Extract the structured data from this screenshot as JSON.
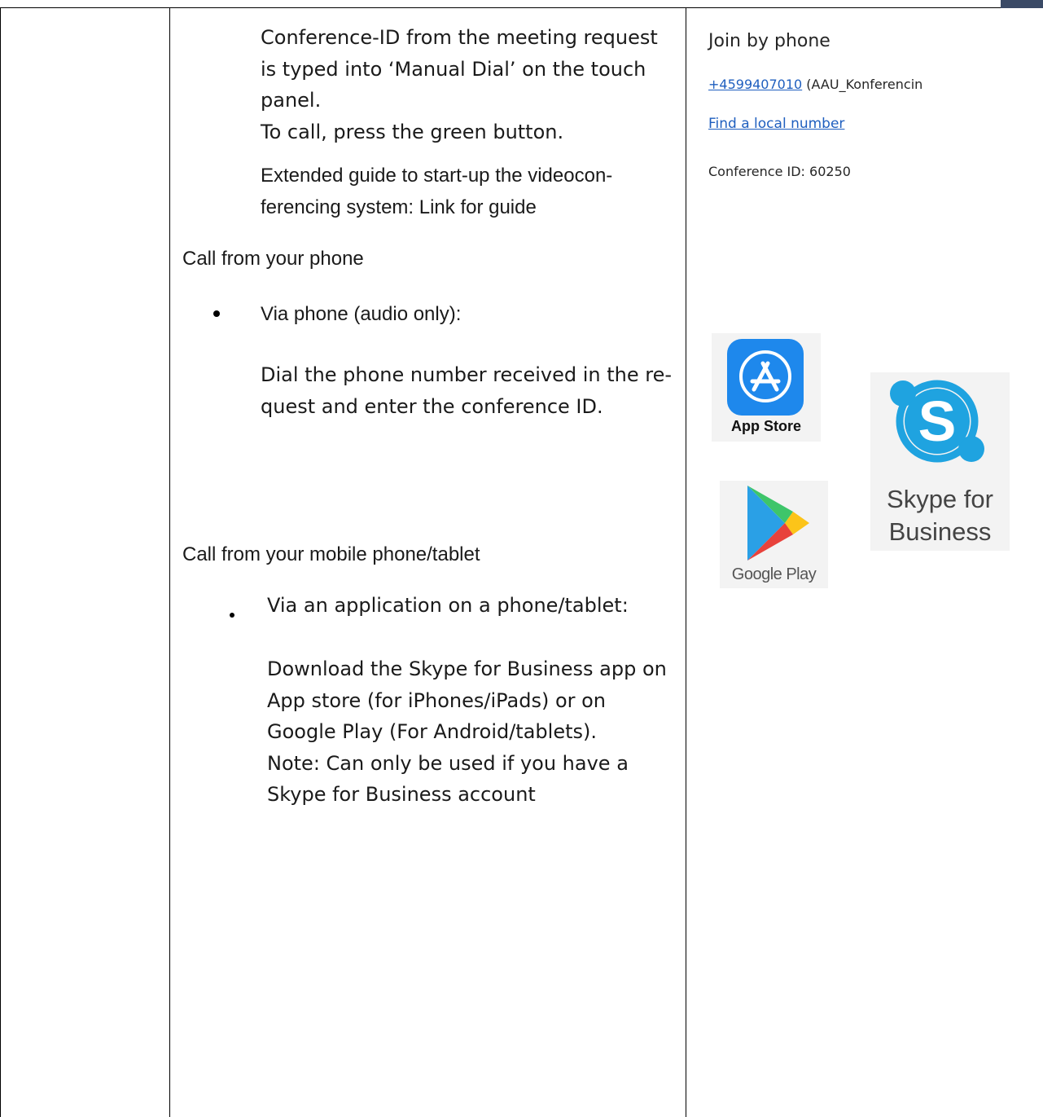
{
  "middle_column": {
    "manual_dial_paragraph": [
      "Conference-ID from the meeting request",
      "is typed into ‘Manual Dial’ on the touch",
      "panel.",
      "To call, press the green button."
    ],
    "guide_paragraph": [
      "Extended guide to start-up the videocon-",
      "ferencing system: Link for guide"
    ],
    "phone_section": {
      "heading": "Call from your phone",
      "bullet": "Via phone (audio only):",
      "description": [
        "Dial the phone number received in the re-",
        "quest and enter the conference ID."
      ]
    },
    "mobile_section": {
      "heading": "Call from your mobile phone/tablet",
      "bullet": "Via an application on a phone/tablet:",
      "description": [
        "Download the Skype for Business app on",
        "App store (for iPhones/iPads) or on",
        "Google Play (For Android/tablets).",
        "Note: Can only be used if you have a",
        "Skype for Business account"
      ]
    }
  },
  "right_column": {
    "join_title": "Join by phone",
    "phone_number": "+4599407010",
    "phone_suffix": " (AAU_Konferencin",
    "local_number_link": "Find a local number",
    "conference_id": "Conference ID: 60250",
    "app_store_label": "App Store",
    "google_play_label": "Google Play",
    "skype_label": [
      "Skype for",
      "Business"
    ]
  },
  "colors": {
    "link": "#1f5fbf",
    "app_store_blue": "#1e88ec",
    "skype_blue": "#1fa3e0"
  }
}
